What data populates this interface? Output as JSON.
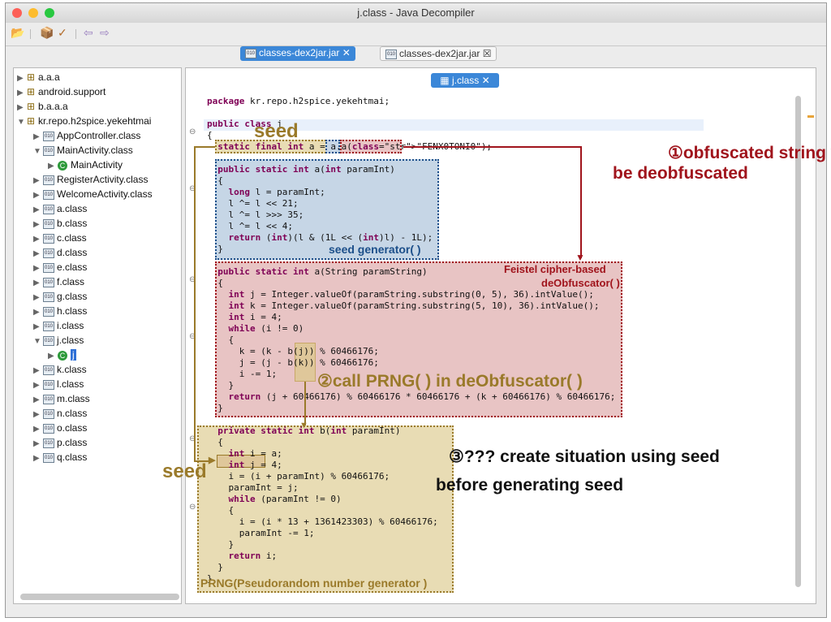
{
  "window": {
    "title": "j.class - Java Decompiler"
  },
  "toolbar": {
    "icons": [
      "folder-open-icon",
      "bookmark-icon",
      "pin-icon",
      "back-icon",
      "forward-icon"
    ]
  },
  "tabs": [
    {
      "label": "classes-dex2jar.jar",
      "close": "✕",
      "active": true
    },
    {
      "label": "classes-dex2jar.jar",
      "close": "☒",
      "active": false
    }
  ],
  "tree": [
    {
      "label": "a.a.a",
      "type": "package"
    },
    {
      "label": "android.support",
      "type": "package"
    },
    {
      "label": "b.a.a.a",
      "type": "package"
    },
    {
      "label": "kr.repo.h2spice.yekehtmai",
      "type": "package-open"
    },
    {
      "label": "AppController.class",
      "type": "class"
    },
    {
      "label": "MainActivity.class",
      "type": "class-open"
    },
    {
      "label": "MainActivity",
      "type": "inner"
    },
    {
      "label": "RegisterActivity.class",
      "type": "class"
    },
    {
      "label": "WelcomeActivity.class",
      "type": "class"
    },
    {
      "label": "a.class",
      "type": "class"
    },
    {
      "label": "b.class",
      "type": "class"
    },
    {
      "label": "c.class",
      "type": "class"
    },
    {
      "label": "d.class",
      "type": "class"
    },
    {
      "label": "e.class",
      "type": "class"
    },
    {
      "label": "f.class",
      "type": "class"
    },
    {
      "label": "g.class",
      "type": "class"
    },
    {
      "label": "h.class",
      "type": "class"
    },
    {
      "label": "i.class",
      "type": "class"
    },
    {
      "label": "j.class",
      "type": "class-open"
    },
    {
      "label": "j",
      "type": "inner-selected"
    },
    {
      "label": "k.class",
      "type": "class"
    },
    {
      "label": "l.class",
      "type": "class"
    },
    {
      "label": "m.class",
      "type": "class"
    },
    {
      "label": "n.class",
      "type": "class"
    },
    {
      "label": "o.class",
      "type": "class"
    },
    {
      "label": "p.class",
      "type": "class"
    },
    {
      "label": "q.class",
      "type": "class"
    }
  ],
  "editor": {
    "tab_label": "j.class",
    "tab_close": "✕"
  },
  "code": [
    "package kr.repo.h2spice.yekehtmai;",
    "",
    "public class j",
    "{",
    "  static final int a = a.a(\"FENX0TONI0\");",
    "",
    "  public static int a(int paramInt)",
    "  {",
    "    long l = paramInt;",
    "    l ^= l << 21;",
    "    l ^= l >>> 35;",
    "    l ^= l << 4;",
    "    return (int)(l & (1L << (int)l) - 1L);",
    "  }",
    "",
    "  public static int a(String paramString)",
    "  {",
    "    int j = Integer.valueOf(paramString.substring(0, 5), 36).intValue();",
    "    int k = Integer.valueOf(paramString.substring(5, 10), 36).intValue();",
    "    int i = 4;",
    "    while (i != 0)",
    "    {",
    "      k = (k - b(j)) % 60466176;",
    "      j = (j - b(k)) % 60466176;",
    "      i -= 1;",
    "    }",
    "    return (j + 60466176) % 60466176 * 60466176 + (k + 60466176) % 60466176;",
    "  }",
    "",
    "  private static int b(int paramInt)",
    "  {",
    "    int i = a;",
    "    int j = 4;",
    "    i = (i + paramInt) % 60466176;",
    "    paramInt = j;",
    "    while (paramInt != 0)",
    "    {",
    "      i = (i * 13 + 1361423303) % 60466176;",
    "      paramInt -= 1;",
    "    }",
    "    return i;",
    "  }",
    "}"
  ],
  "annotations": {
    "seed_top": "seed",
    "seed_left": "seed",
    "obfuscated_line1": "①obfuscated string will",
    "obfuscated_line2": "be deobfuscated",
    "seed_generator": "seed generator( )",
    "feistel_line1": "Feistel cipher-based",
    "feistel_line2": "deObfuscator( )",
    "call_prng": "②call PRNG( ) in deObfuscator( )",
    "create_line1": "③??? create situation using seed",
    "create_line2": "before generating seed",
    "prng_label": "PRNG(Pseudorandom number generator )"
  },
  "colors": {
    "seed_brown": "#9a7a2a",
    "blue_box": "#c6d6e6",
    "red_box": "#e8c4c4",
    "tan_box": "#e8dcb4",
    "dark_red": "#a0141c",
    "dark_blue": "#1c4f8a"
  }
}
